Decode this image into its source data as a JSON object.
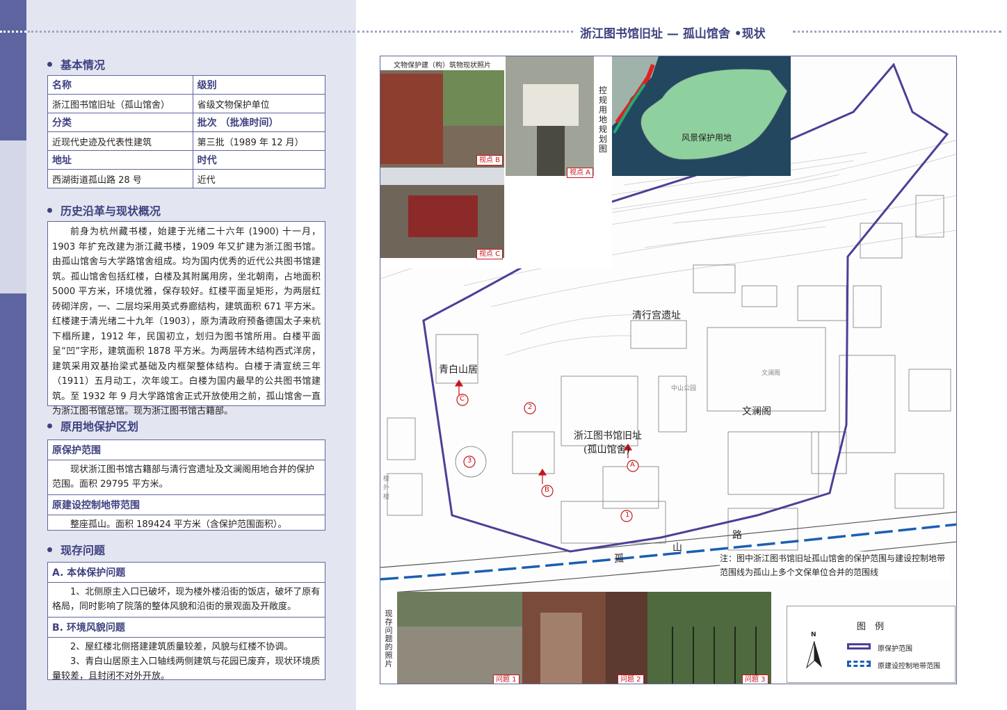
{
  "header": {
    "title": "浙江图书馆旧址 — 孤山馆舍 •现状"
  },
  "sections": {
    "basic": "基本情况",
    "history": "历史沿革与现状概况",
    "zoning": "原用地保护区划",
    "problems": "现存问题"
  },
  "basic_table": {
    "name_h": "名称",
    "name_v": "浙江图书馆旧址（孤山馆舍）",
    "level_h": "级别",
    "level_v": "省级文物保护单位",
    "type_h": "分类",
    "type_v": "近现代史迹及代表性建筑",
    "batch_h": "批次 （批准时间）",
    "batch_v": "第三批（1989 年 12 月）",
    "addr_h": "地址",
    "addr_v": "西湖街道孤山路 28 号",
    "era_h": "时代",
    "era_v": "近代"
  },
  "history_text": "前身为杭州藏书楼，始建于光绪二十六年 (1900) 十一月，1903 年扩充改建为浙江藏书楼，1909 年又扩建为浙江图书馆。由孤山馆舍与大学路馆舍组成。均为国内优秀的近代公共图书馆建筑。孤山馆舍包括红楼，白楼及其附属用房，坐北朝南，占地面积 5000 平方米，环境优雅，保存较好。红楼平面呈矩形，为两层红砖砌洋房，一、二层均采用英式券廊结构，建筑面积 671 平方米。红楼建于清光绪二十九年（1903），原为清政府预备德国太子来杭下榻所建，1912 年，民国初立，划归为图书馆所用。白楼平面呈“凹”字形，建筑面积 1878 平方米。为两层砖木结构西式洋房，建筑采用双基抬梁式基础及内框架整体结构。白楼于清宣统三年（1911）五月动工，次年竣工。白楼为国内最早的公共图书馆建筑。至 1932 年 9 月大学路馆舍正式开放使用之前，孤山馆舍一直为浙江图书馆总馆。现为浙江图书馆古籍部。",
  "zoning": {
    "scope_h": "原保护范围",
    "scope_v": "现状浙江图书馆古籍部与清行宫遗址及文澜阁用地合并的保护范围。面积 29795 平方米。",
    "control_h": "原建设控制地带范围",
    "control_v": "整座孤山。面积 189424 平方米（含保护范围面积）。"
  },
  "problems": {
    "a_h": "A. 本体保护问题",
    "a_v": "1、北侧原主入口已破坏，现为楼外楼沿街的饭店，破坏了原有格局，同时影响了院落的整体风貌和沿街的景观面及开敞度。",
    "b_h": "B. 环境风貌问题",
    "b_v1": "2、屋红楼北侧搭建建筑质量较差，风貌与红楼不协调。",
    "b_v2": "3、青白山居原主入口轴线两侧建筑与花园已废弃，现状环境质量较差，且封闭不对外开放。"
  },
  "map": {
    "photo_caption": "文物保护建（构）筑物现状照片",
    "view_a": "视点 A",
    "view_b": "视点 B",
    "view_c": "视点 C",
    "plan_label": "控规用地规划图",
    "scenic": "风景保护用地",
    "qinggong": "清行宫遗址",
    "qingbai": "青白山居",
    "site1": "浙江图书馆旧址",
    "site2": "(孤山馆舍)",
    "wenlan": "文澜阁",
    "road_gu": "孤",
    "road_shan": "山",
    "road_lu": "路",
    "note": "注：图中浙江图书馆旧址孤山馆舍的保护范围与建设控制地带范围线为孤山上多个文保单位合并的范围线",
    "problem_label": "现存问题的照片",
    "p1": "问题 1",
    "p2": "问题 2",
    "p3": "问题 3",
    "legend_title": "图　例",
    "legend_1": "原保护范围",
    "legend_2": "原建设控制地带范围",
    "north": "N",
    "num1": "1",
    "num2": "2",
    "num3": "3",
    "letA": "A",
    "letB": "B",
    "letC": "C",
    "small_zhongshan": "中山公园",
    "small_wenlange": "文澜阁",
    "small_louwailou": "楼外楼"
  },
  "colors": {
    "accent": "#3e4180",
    "boundary": "#4b3f97",
    "control_line": "#1b5fb0",
    "scenic_green": "#8fd19e",
    "water": "#22475e",
    "marker_red": "#c4161c"
  }
}
